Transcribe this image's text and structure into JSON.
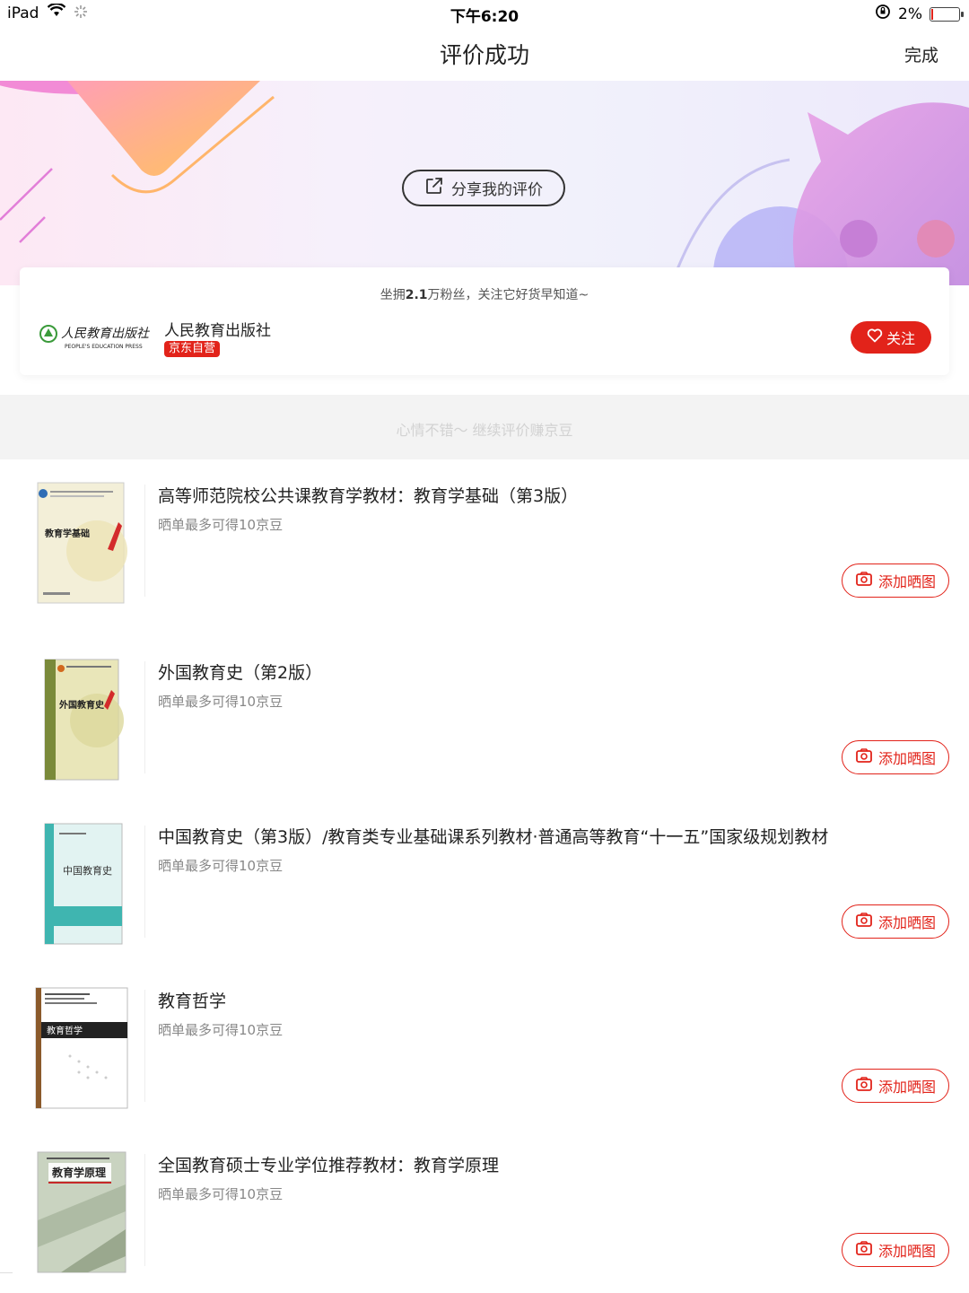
{
  "status_bar": {
    "device": "iPad",
    "time": "下午6:20",
    "battery": "2%"
  },
  "nav": {
    "title": "评价成功",
    "done": "完成"
  },
  "banner": {
    "share_label": "分享我的评价"
  },
  "shop": {
    "tip_prefix": "坐拥",
    "tip_fans": "2.1",
    "tip_suffix": "万粉丝，关注它好货早知道~",
    "name": "人民教育出版社",
    "badge": "京东自营",
    "logo_text": "人民教育出版社",
    "logo_subtext": "PEOPLE'S EDUCATION PRESS",
    "follow_label": "关注"
  },
  "tip_strip": "心情不错～ 继续评价赚京豆",
  "products": [
    {
      "title": "高等师范院校公共课教育学教材：教育学基础（第3版）",
      "hint": "晒单最多可得10京豆",
      "button": "添加晒图",
      "cover_title": "教育学基础"
    },
    {
      "title": "外国教育史（第2版）",
      "hint": "晒单最多可得10京豆",
      "button": "添加晒图",
      "cover_title": "外国教育史"
    },
    {
      "title": "中国教育史（第3版）/教育类专业基础课系列教材·普通高等教育“十一五”国家级规划教材",
      "hint": "晒单最多可得10京豆",
      "button": "添加晒图",
      "cover_title": "中国教育史"
    },
    {
      "title": "教育哲学",
      "hint": "晒单最多可得10京豆",
      "button": "添加晒图",
      "cover_title": "教育哲学"
    },
    {
      "title": "全国教育硕士专业学位推荐教材：教育学原理",
      "hint": "晒单最多可得10京豆",
      "button": "添加晒图",
      "cover_title": "教育学原理"
    }
  ],
  "colors": {
    "accent": "#e2231a"
  }
}
